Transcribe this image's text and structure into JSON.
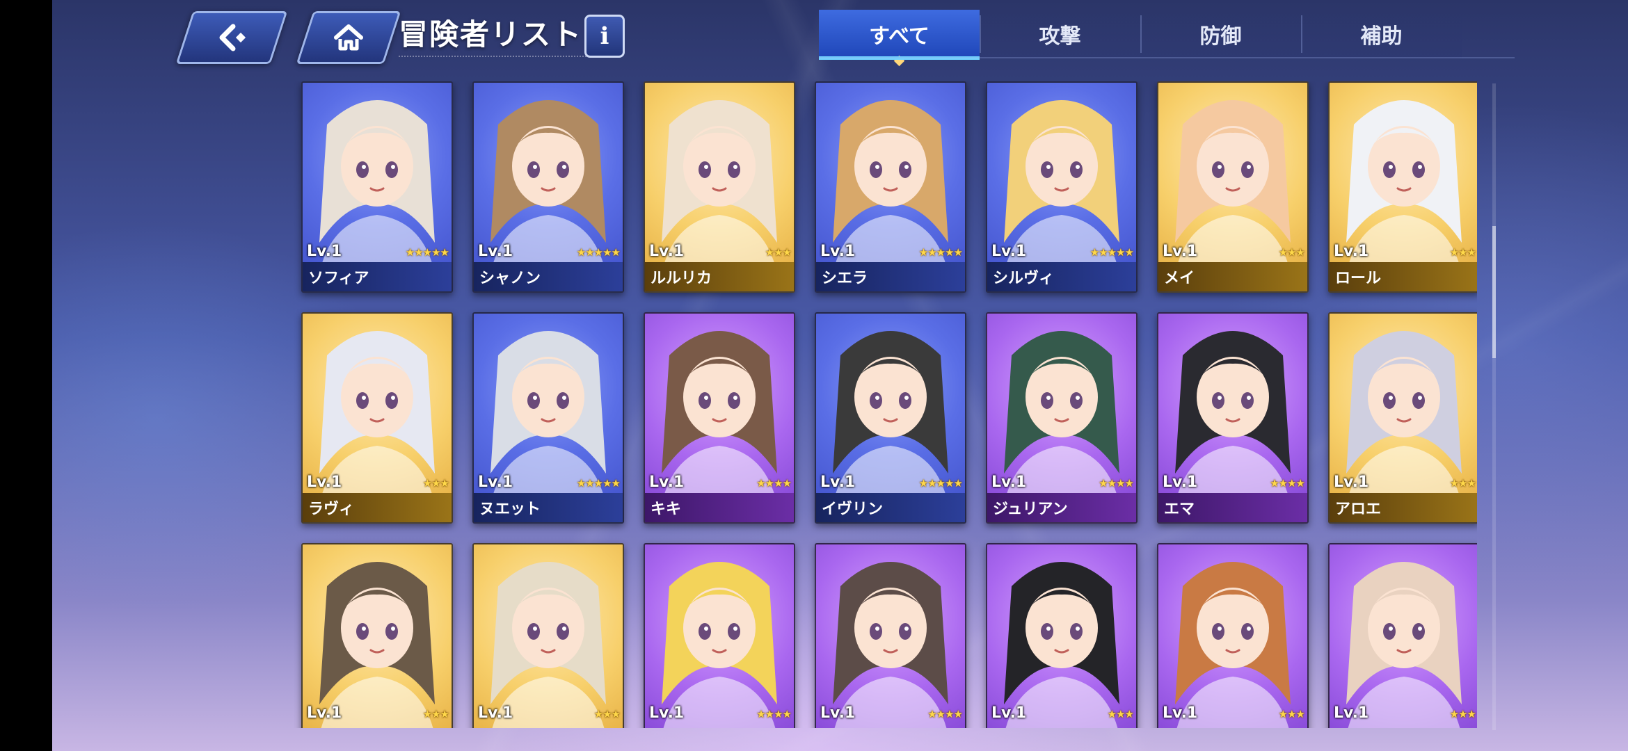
{
  "header": {
    "title": "冒険者リスト",
    "info_label": "i",
    "back_icon": "back-arrow-icon",
    "home_icon": "home-icon"
  },
  "tabs": [
    {
      "label": "すべて",
      "active": true
    },
    {
      "label": "攻撃",
      "active": false
    },
    {
      "label": "防御",
      "active": false
    },
    {
      "label": "補助",
      "active": false
    }
  ],
  "colors": {
    "blue_card": "#5a6ee6",
    "gold_card": "#f7cf6a",
    "purple_card": "#a967ef",
    "tab_active": "#2f5ad0"
  },
  "adventurers": [
    {
      "name": "ソフィア",
      "level": "Lv.1",
      "stars": 5,
      "color": "blue"
    },
    {
      "name": "シャノン",
      "level": "Lv.1",
      "stars": 5,
      "color": "blue"
    },
    {
      "name": "ルルリカ",
      "level": "Lv.1",
      "stars": 3,
      "color": "gold"
    },
    {
      "name": "シエラ",
      "level": "Lv.1",
      "stars": 5,
      "color": "blue"
    },
    {
      "name": "シルヴィ",
      "level": "Lv.1",
      "stars": 5,
      "color": "blue"
    },
    {
      "name": "メイ",
      "level": "Lv.1",
      "stars": 3,
      "color": "gold"
    },
    {
      "name": "ロール",
      "level": "Lv.1",
      "stars": 3,
      "color": "gold"
    },
    {
      "name": "ラヴィ",
      "level": "Lv.1",
      "stars": 3,
      "color": "gold"
    },
    {
      "name": "ヌエット",
      "level": "Lv.1",
      "stars": 5,
      "color": "blue"
    },
    {
      "name": "キキ",
      "level": "Lv.1",
      "stars": 4,
      "color": "purple"
    },
    {
      "name": "イヴリン",
      "level": "Lv.1",
      "stars": 5,
      "color": "blue"
    },
    {
      "name": "ジュリアン",
      "level": "Lv.1",
      "stars": 4,
      "color": "purple"
    },
    {
      "name": "エマ",
      "level": "Lv.1",
      "stars": 4,
      "color": "purple"
    },
    {
      "name": "アロエ",
      "level": "Lv.1",
      "stars": 3,
      "color": "gold"
    },
    {
      "name": "",
      "level": "Lv.1",
      "stars": 3,
      "color": "gold"
    },
    {
      "name": "",
      "level": "Lv.1",
      "stars": 3,
      "color": "gold"
    },
    {
      "name": "",
      "level": "Lv.1",
      "stars": 4,
      "color": "purple"
    },
    {
      "name": "",
      "level": "Lv.1",
      "stars": 4,
      "color": "purple"
    },
    {
      "name": "",
      "level": "Lv.1",
      "stars": 3,
      "color": "purple"
    },
    {
      "name": "",
      "level": "Lv.1",
      "stars": 3,
      "color": "purple"
    },
    {
      "name": "",
      "level": "Lv.1",
      "stars": 3,
      "color": "purple"
    }
  ]
}
